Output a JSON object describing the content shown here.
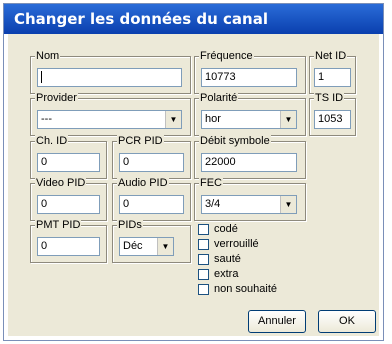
{
  "window": {
    "title": "Changer les données du canal"
  },
  "fields": {
    "nom": {
      "label": "Nom",
      "value": ""
    },
    "frequence": {
      "label": "Fréquence",
      "value": "10773"
    },
    "net_id": {
      "label": "Net ID",
      "value": "1"
    },
    "provider": {
      "label": "Provider",
      "value": "---"
    },
    "polarite": {
      "label": "Polarité",
      "value": "hor"
    },
    "ts_id": {
      "label": "TS ID",
      "value": "1053"
    },
    "ch_id": {
      "label": "Ch. ID",
      "value": "0"
    },
    "pcr_pid": {
      "label": "PCR PID",
      "value": "0"
    },
    "debit": {
      "label": "Débit symbole",
      "value": "22000"
    },
    "video_pid": {
      "label": "Video PID",
      "value": "0"
    },
    "audio_pid": {
      "label": "Audio PID",
      "value": "0"
    },
    "fec": {
      "label": "FEC",
      "value": "3/4"
    },
    "pmt_pid": {
      "label": "PMT PID",
      "value": "0"
    },
    "pids": {
      "label": "PIDs",
      "value": "Déc"
    }
  },
  "checkboxes": [
    {
      "label": "codé",
      "checked": false
    },
    {
      "label": "verrouillé",
      "checked": false
    },
    {
      "label": "sauté",
      "checked": false
    },
    {
      "label": "extra",
      "checked": false
    },
    {
      "label": "non souhaité",
      "checked": false
    }
  ],
  "buttons": {
    "cancel": "Annuler",
    "ok": "OK"
  },
  "icons": {
    "dropdown": "dropdown-arrow-icon"
  }
}
